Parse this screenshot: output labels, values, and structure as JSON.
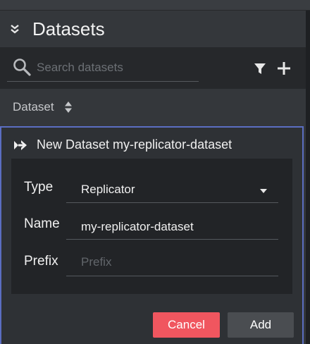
{
  "panel": {
    "title": "Datasets",
    "collapse_icon": "double-chevron-down-icon"
  },
  "search": {
    "placeholder": "Search datasets",
    "value": "",
    "icon": "search-icon",
    "filter_icon": "filter-icon",
    "add_icon": "plus-icon"
  },
  "list": {
    "column_header": "Dataset",
    "sort_icon": "sort-icon"
  },
  "new_dataset": {
    "header_icon": "double-arrow-right-icon",
    "title": "New Dataset my-replicator-dataset",
    "form": {
      "type_label": "Type",
      "type_value": "Replicator",
      "name_label": "Name",
      "name_value": "my-replicator-dataset",
      "prefix_label": "Prefix",
      "prefix_placeholder": "Prefix",
      "prefix_value": ""
    },
    "cancel_label": "Cancel",
    "add_label": "Add"
  },
  "colors": {
    "accent_border": "#5b6ec2",
    "cancel_button": "#f0565f",
    "add_button": "#4a4d51",
    "panel_bg": "#34373b",
    "search_bg": "#26282b",
    "form_bg": "#222427"
  }
}
